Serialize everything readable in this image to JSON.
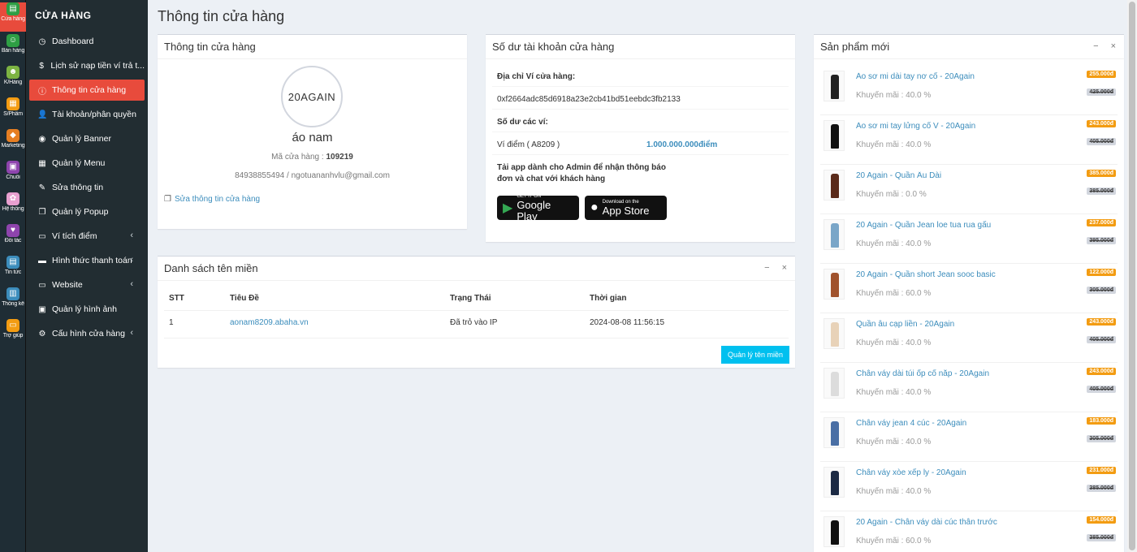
{
  "rail": [
    {
      "label": "Cửa hàng",
      "icon": "store-icon",
      "glyph": "▤",
      "color": "#2e9e44",
      "active": true
    },
    {
      "label": "Bán hàng",
      "icon": "sales-icon",
      "glyph": "☺",
      "color": "#2e9e44"
    },
    {
      "label": "K/Hàng",
      "icon": "customer-icon",
      "glyph": "☻",
      "color": "#7cb342"
    },
    {
      "label": "S/Phẩm",
      "icon": "product-icon",
      "glyph": "▦",
      "color": "#f39c12"
    },
    {
      "label": "Marketing",
      "icon": "marketing-icon",
      "glyph": "◆",
      "color": "#e67e22"
    },
    {
      "label": "Chuỗi",
      "icon": "chain-icon",
      "glyph": "▣",
      "color": "#8e44ad"
    },
    {
      "label": "Hệ thống",
      "icon": "system-icon",
      "glyph": "✿",
      "color": "#e8a0d0"
    },
    {
      "label": "Đối tác",
      "icon": "partner-icon",
      "glyph": "♥",
      "color": "#8e44ad"
    },
    {
      "label": "Tin tức",
      "icon": "news-icon",
      "glyph": "▤",
      "color": "#3c8dbc"
    },
    {
      "label": "Thống kê",
      "icon": "stats-icon",
      "glyph": "▥",
      "color": "#3c8dbc"
    },
    {
      "label": "Trợ giúp",
      "icon": "help-icon",
      "glyph": "▭",
      "color": "#f39c12"
    }
  ],
  "sidebar": {
    "title": "CỬA HÀNG",
    "items": [
      {
        "label": "Dashboard",
        "icon": "dashboard-icon",
        "glyph": "◷"
      },
      {
        "label": "Lịch sử nạp tiền ví trả t...",
        "icon": "dollar-icon",
        "glyph": "$"
      },
      {
        "label": "Thông tin cửa hàng",
        "icon": "info-icon",
        "glyph": "ⓘ",
        "active": true
      },
      {
        "label": "Tài khoản/phân quyền",
        "icon": "user-icon",
        "glyph": "👤"
      },
      {
        "label": "Quản lý Banner",
        "icon": "banner-icon",
        "glyph": "◉"
      },
      {
        "label": "Quản lý Menu",
        "icon": "menu-grid-icon",
        "glyph": "▦"
      },
      {
        "label": "Sửa thông tin",
        "icon": "edit-icon",
        "glyph": "✎"
      },
      {
        "label": "Quản lý Popup",
        "icon": "popup-icon",
        "glyph": "❐"
      },
      {
        "label": "Ví tích điểm",
        "icon": "wallet-icon",
        "glyph": "▭",
        "caret": "‹"
      },
      {
        "label": "Hình thức thanh toán",
        "icon": "payment-icon",
        "glyph": "▬",
        "caret": "‹"
      },
      {
        "label": "Website",
        "icon": "website-icon",
        "glyph": "▭",
        "caret": "‹"
      },
      {
        "label": "Quản lý hình ảnh",
        "icon": "image-icon",
        "glyph": "▣"
      },
      {
        "label": "Cấu hình cửa hàng",
        "icon": "gear-icon",
        "glyph": "⚙",
        "caret": "‹"
      }
    ]
  },
  "page_title": "Thông tin cửa hàng",
  "shop_box": {
    "title": "Thông tin cửa hàng",
    "logo_text": "20AGAIN",
    "name": "áo nam",
    "code_label": "Mã cửa hàng : ",
    "code_value": "109219",
    "contact": "84938855494 / ngotuananhvlu@gmail.com",
    "edit_link": "Sửa thông tin cửa hàng"
  },
  "wallet_box": {
    "title": "Số dư tài khoản cửa hàng",
    "address_label": "Địa chỉ Ví cửa hàng:",
    "address": "0xf2664adc85d6918a23e2cb41bd51eebdc3fb2133",
    "balance_label": "Số dư các ví:",
    "wallet_name": "Ví điểm ( A8209 )",
    "wallet_value": "1.000.000.000điểm",
    "app_text_1": "Tải app dành cho Admin để nhận thông báo",
    "app_text_2": "đơn và chat với khách hàng",
    "google_small": "GET IT ON",
    "google_big": "Google Play",
    "apple_small": "Download on the",
    "apple_big": "App Store"
  },
  "domain_box": {
    "title": "Danh sách tên miền",
    "tool_minimize": "−",
    "tool_close": "×",
    "columns": [
      "STT",
      "Tiêu Đề",
      "Trạng Thái",
      "Thời gian"
    ],
    "rows": [
      {
        "stt": "1",
        "title": "aonam8209.abaha.vn",
        "status": "Đã trỏ vào IP",
        "time": "2024-08-08 11:56:15"
      }
    ],
    "manage_button": "Quản lý tên miền"
  },
  "products_box": {
    "title": "Sản phẩm mới",
    "tool_minimize": "−",
    "tool_close": "×",
    "items": [
      {
        "name": "Áo sơ mi dài tay nơ cổ - 20Again",
        "promo": "Khuyến mãi : 40.0 %",
        "price": "255.000đ",
        "old_price": "425.000đ",
        "color": "#222"
      },
      {
        "name": "Áo sơ mi tay lửng cổ V - 20Again",
        "promo": "Khuyến mãi : 40.0 %",
        "price": "243.000đ",
        "old_price": "405.000đ",
        "color": "#111"
      },
      {
        "name": "20 Again - Quần Âu Dài",
        "promo": "Khuyến mãi : 0.0 %",
        "price": "385.000đ",
        "old_price": "385.000đ",
        "color": "#5a2a1a"
      },
      {
        "name": "20 Again - Quần Jean loe tua rua gấu",
        "promo": "Khuyến mãi : 40.0 %",
        "price": "237.000đ",
        "old_price": "395.000đ",
        "color": "#7aa6c8"
      },
      {
        "name": "20 Again - Quần short Jean sooc basic",
        "promo": "Khuyến mãi : 60.0 %",
        "price": "122.000đ",
        "old_price": "305.000đ",
        "color": "#a0522d"
      },
      {
        "name": "Quần âu cạp liền - 20Again",
        "promo": "Khuyến mãi : 40.0 %",
        "price": "243.000đ",
        "old_price": "405.000đ",
        "color": "#e8d2b8"
      },
      {
        "name": "Chân váy dài túi ốp cổ nắp - 20Again",
        "promo": "Khuyến mãi : 40.0 %",
        "price": "243.000đ",
        "old_price": "405.000đ",
        "color": "#dcdcdc"
      },
      {
        "name": "Chân váy jean 4 cúc - 20Again",
        "promo": "Khuyến mãi : 40.0 %",
        "price": "183.000đ",
        "old_price": "305.000đ",
        "color": "#4a6fa5"
      },
      {
        "name": "Chân váy xòe xếp ly - 20Again",
        "promo": "Khuyến mãi : 40.0 %",
        "price": "231.000đ",
        "old_price": "385.000đ",
        "color": "#1c2a44"
      },
      {
        "name": "20 Again - Chân váy dài cúc thân trước",
        "promo": "Khuyến mãi : 60.0 %",
        "price": "154.000đ",
        "old_price": "385.000đ",
        "color": "#111"
      }
    ]
  }
}
